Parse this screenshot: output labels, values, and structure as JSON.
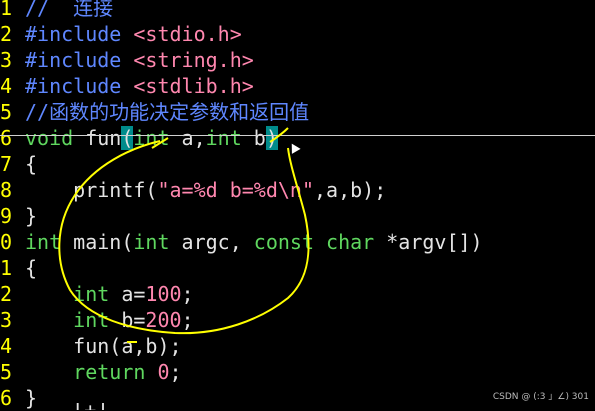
{
  "editor": {
    "lines": [
      {
        "num": "1",
        "segments": [
          {
            "c": "cmt",
            "t": "//  连接"
          }
        ]
      },
      {
        "num": "2",
        "segments": [
          {
            "c": "pp",
            "t": "#include "
          },
          {
            "c": "str",
            "t": "<stdio.h>"
          }
        ]
      },
      {
        "num": "3",
        "segments": [
          {
            "c": "pp",
            "t": "#include "
          },
          {
            "c": "str",
            "t": "<string.h>"
          }
        ]
      },
      {
        "num": "4",
        "segments": [
          {
            "c": "pp",
            "t": "#include "
          },
          {
            "c": "str",
            "t": "<stdlib.h>"
          }
        ]
      },
      {
        "num": "5",
        "segments": [
          {
            "c": "cmt",
            "t": "//函数的功能决定参数和返回值"
          }
        ]
      },
      {
        "num": "6",
        "segments": [
          {
            "c": "kw",
            "t": "void"
          },
          {
            "c": "txt",
            "t": " fun"
          },
          {
            "c": "paren",
            "t": "("
          },
          {
            "c": "kw",
            "t": "int"
          },
          {
            "c": "txt",
            "t": " a,"
          },
          {
            "c": "kw",
            "t": "int"
          },
          {
            "c": "txt",
            "t": " b"
          },
          {
            "c": "paren",
            "t": ")"
          }
        ]
      },
      {
        "num": "7",
        "segments": [
          {
            "c": "txt",
            "t": "{"
          }
        ]
      },
      {
        "num": "8",
        "segments": [
          {
            "c": "txt",
            "t": "    printf("
          },
          {
            "c": "str",
            "t": "\"a=%d b=%d"
          },
          {
            "c": "esc",
            "t": "\\n"
          },
          {
            "c": "str",
            "t": "\""
          },
          {
            "c": "txt",
            "t": ",a,b);"
          }
        ]
      },
      {
        "num": "9",
        "segments": [
          {
            "c": "txt",
            "t": "}"
          }
        ]
      },
      {
        "num": "0",
        "segments": [
          {
            "c": "kw",
            "t": "int"
          },
          {
            "c": "txt",
            "t": " main("
          },
          {
            "c": "kw",
            "t": "int"
          },
          {
            "c": "txt",
            "t": " argc, "
          },
          {
            "c": "kw",
            "t": "const char"
          },
          {
            "c": "txt",
            "t": " *argv[])"
          }
        ]
      },
      {
        "num": "1",
        "segments": [
          {
            "c": "txt",
            "t": "{"
          }
        ]
      },
      {
        "num": "2",
        "segments": [
          {
            "c": "txt",
            "t": "    "
          },
          {
            "c": "kw",
            "t": "int"
          },
          {
            "c": "txt",
            "t": " a="
          },
          {
            "c": "num",
            "t": "100"
          },
          {
            "c": "txt",
            "t": ";"
          }
        ]
      },
      {
        "num": "3",
        "segments": [
          {
            "c": "txt",
            "t": "    "
          },
          {
            "c": "kw",
            "t": "int"
          },
          {
            "c": "txt",
            "t": " b="
          },
          {
            "c": "num",
            "t": "200"
          },
          {
            "c": "txt",
            "t": ";"
          }
        ]
      },
      {
        "num": "4",
        "segments": [
          {
            "c": "txt",
            "t": "    fun(a,b);"
          }
        ]
      },
      {
        "num": "5",
        "segments": [
          {
            "c": "txt",
            "t": "    "
          },
          {
            "c": "kw",
            "t": "return"
          },
          {
            "c": "txt",
            "t": " "
          },
          {
            "c": "num",
            "t": "0"
          },
          {
            "c": "txt",
            "t": ";"
          }
        ]
      },
      {
        "num": "6",
        "segments": [
          {
            "c": "txt",
            "t": "}"
          }
        ]
      }
    ]
  },
  "status": {
    "text": "-- --  [+]"
  },
  "watermark": {
    "text": "CSDN @ (:3 」∠) 301"
  },
  "colors": {
    "background": "#000000",
    "line_number": "#FFFF00",
    "keyword": "#5FD75F",
    "preprocessor": "#5F87FF",
    "string": "#FF87AF",
    "paren_match": "#008B8B",
    "annotation": "#FFFF00"
  }
}
